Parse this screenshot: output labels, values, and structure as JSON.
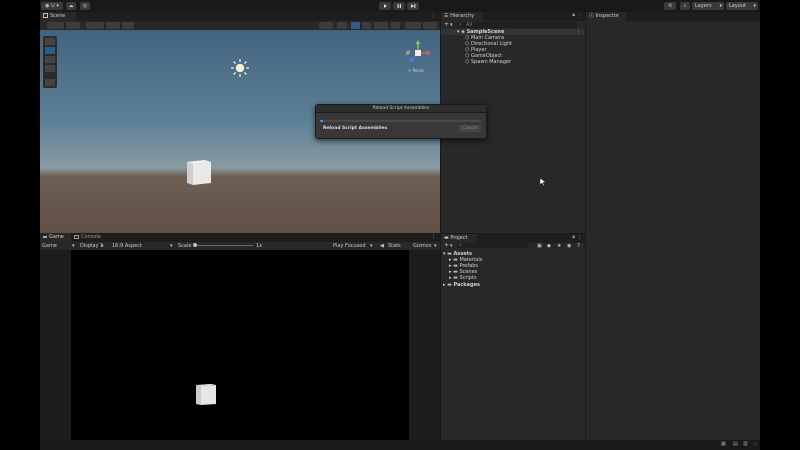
{
  "toolbar": {
    "account_label": "U",
    "play_icon": "play-icon",
    "pause_icon": "pause-icon",
    "step_icon": "step-icon",
    "layers_label": "Layers",
    "layout_label": "Layout"
  },
  "scene": {
    "tab_label": "Scene",
    "persp_label": "< Persp"
  },
  "game": {
    "tabs": [
      {
        "label": "Game"
      },
      {
        "label": "Console"
      }
    ],
    "mode_label": "Game",
    "display_label": "Display 1",
    "aspect_label": "16:9 Aspect",
    "scale_label": "Scale",
    "scale_value": "1x",
    "play_focused_label": "Play Focused",
    "stats_label": "Stats",
    "gizmos_label": "Gizmos"
  },
  "hierarchy": {
    "tab_label": "Hierarchy",
    "search_placeholder": "All",
    "scene_name": "SampleScene",
    "items": [
      {
        "label": "Main Camera"
      },
      {
        "label": "Directional Light"
      },
      {
        "label": "Player"
      },
      {
        "label": "GameObject"
      },
      {
        "label": "Spawn Manager"
      }
    ]
  },
  "inspector": {
    "tab_label": "Inspector"
  },
  "project": {
    "tab_label": "Project",
    "root": "Assets",
    "folders": [
      {
        "label": "Materials"
      },
      {
        "label": "Prefabs"
      },
      {
        "label": "Scenes"
      },
      {
        "label": "Scripts"
      }
    ],
    "packages_label": "Packages"
  },
  "dialog": {
    "title": "Reload Script Assemblies",
    "message": "Reload Script Assemblies",
    "cancel_label": "Cancel",
    "progress": 0.02
  },
  "colors": {
    "panel_bg": "#282828",
    "toolbar_bg": "#191919",
    "accent_blue": "#3d8fe0",
    "sky_top": "#42637e",
    "ground": "#5f4f44"
  }
}
